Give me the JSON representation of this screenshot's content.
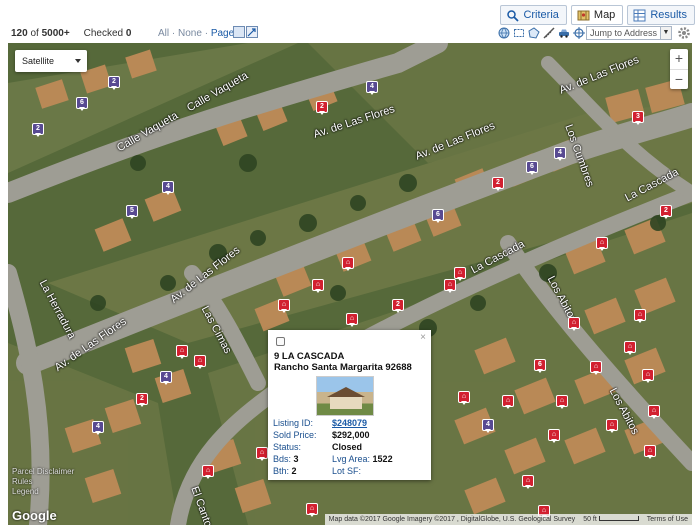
{
  "tabs": [
    {
      "label": "Criteria",
      "icon": "search-icon",
      "active": false
    },
    {
      "label": "Map",
      "icon": "map-icon",
      "active": true
    },
    {
      "label": "Results",
      "icon": "grid-icon",
      "active": false
    }
  ],
  "toolbar": {
    "count_shown": "120",
    "count_of": "of",
    "count_total": "5000+",
    "checked_label": "Checked",
    "checked_value": "0",
    "select_all": "All",
    "select_none": "None",
    "select_page": "Page",
    "jump_placeholder": "Jump to Address"
  },
  "map": {
    "type_label": "Satellite",
    "zoom_in": "+",
    "zoom_out": "−",
    "streets": [
      {
        "name": "Calle Vaqueta"
      },
      {
        "name": "Calle Vaqueta"
      },
      {
        "name": "Av. de Las Flores"
      },
      {
        "name": "Av. de Las Flores"
      },
      {
        "name": "Av. de Las Flores"
      },
      {
        "name": "Av. de Las Flores"
      },
      {
        "name": "Av. de Las Flores"
      },
      {
        "name": "Los Cumbres"
      },
      {
        "name": "La Cascada"
      },
      {
        "name": "La Cascada"
      },
      {
        "name": "La Herradura"
      },
      {
        "name": "Las Cimas"
      },
      {
        "name": "Los Abitos"
      },
      {
        "name": "Los Abitos"
      },
      {
        "name": "El Canto"
      }
    ],
    "google_label": "Google",
    "side_links": [
      "Parcel",
      "Disclaimer",
      "Rules",
      "Legend"
    ],
    "attribution": "Map data ©2017 Google Imagery ©2017 , DigitalGlobe, U.S. Geological Survey",
    "scale_label": "50 ft",
    "terms": "Terms of Use"
  },
  "popup": {
    "close": "×",
    "address_line1": "9 LA CASCADA",
    "address_line2": "Rancho Santa Margarita 92688",
    "listing_id_label": "Listing ID:",
    "listing_id": "$248079",
    "sold_price_label": "Sold Price:",
    "sold_price": "$292,000",
    "status_label": "Status:",
    "status": "Closed",
    "bds_label": "Bds:",
    "bds": "3",
    "lvg_area_label": "Lvg Area:",
    "lvg_area": "1522",
    "bth_label": "Bth:",
    "bth": "2",
    "lot_sf_label": "Lot SF:",
    "lot_sf": ""
  },
  "colors": {
    "red_pin": "#d22030",
    "purple_pin": "#584a92",
    "link_blue": "#1a5aa6"
  }
}
